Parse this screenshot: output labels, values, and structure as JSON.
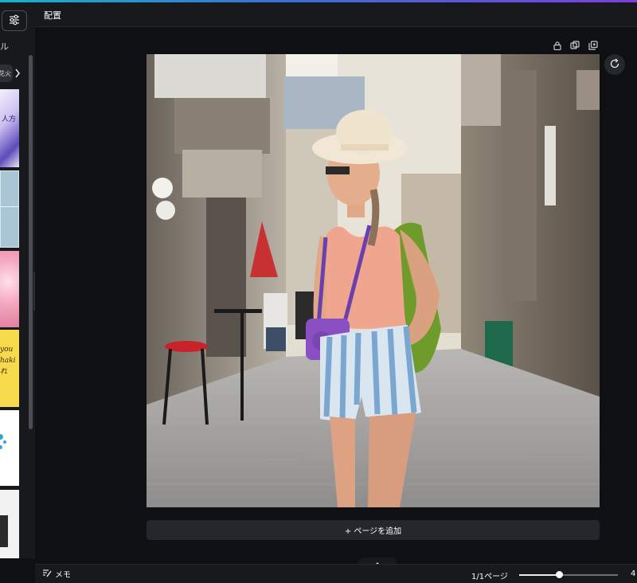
{
  "header": {
    "title": "配置"
  },
  "sidebar": {
    "label": "ル",
    "chip_label": "花火",
    "thumbnails": [
      {
        "text": "人方"
      },
      {
        "text": ""
      },
      {
        "text": ""
      },
      {
        "text": "you\nhaki\nれ"
      },
      {
        "text": ""
      },
      {
        "text": ""
      }
    ]
  },
  "canvas": {
    "add_page_label": "+ ページを追加"
  },
  "footer": {
    "notes_label": "メモ",
    "page_indicator": "1/1ページ",
    "zoom_level": 0.4,
    "zoom_label": "4"
  },
  "icons": {
    "filter": "sliders-icon",
    "lock": "lock-icon",
    "duplicate": "duplicate-icon",
    "add_page": "add-page-icon",
    "refresh": "refresh-icon",
    "notes": "notes-icon",
    "chevron_up": "chevron-up-icon",
    "chevron_left": "chevron-left-icon",
    "chevron_right": "chevron-right-icon"
  },
  "colors": {
    "accent_gradient_start": "#16b4c9",
    "accent_gradient_end": "#7c3ee0",
    "panel": "#17191c",
    "canvas_bg": "#0e1013"
  }
}
